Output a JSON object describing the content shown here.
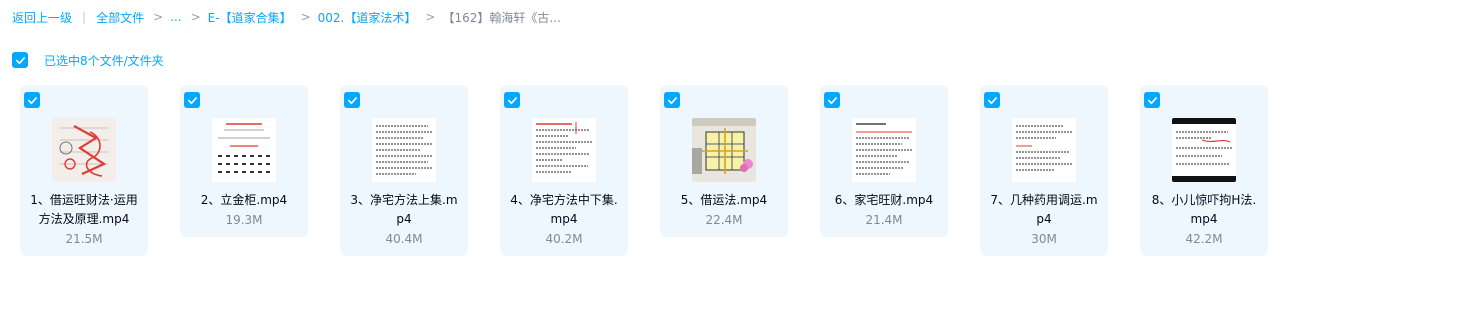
{
  "breadcrumb": {
    "back": "返回上一级",
    "separator": "|",
    "all_files": "全部文件",
    "ellipsis": "...",
    "level1": "E-【道家合集】",
    "level2": "002.【道家法术】",
    "current": "【162】翰海轩《古..."
  },
  "selection": {
    "text": "已选中8个文件/文件夹",
    "checked": true
  },
  "files": [
    {
      "name": "1、借运旺财法·运用方法及原理.mp4",
      "size": "21.5M",
      "thumb_icon": "red-ink-talisman-thumbnail"
    },
    {
      "name": "2、立金柜.mp4",
      "size": "19.3M",
      "thumb_icon": "character-grid-thumbnail"
    },
    {
      "name": "3、净宅方法上集.mp4",
      "size": "40.4M",
      "thumb_icon": "text-document-thumbnail"
    },
    {
      "name": "4、净宅方法中下集.mp4",
      "size": "40.2M",
      "thumb_icon": "text-document-red-thumbnail"
    },
    {
      "name": "5、借运法.mp4",
      "size": "22.4M",
      "thumb_icon": "diagram-photo-thumbnail"
    },
    {
      "name": "6、家宅旺财.mp4",
      "size": "21.4M",
      "thumb_icon": "text-document-thumbnail"
    },
    {
      "name": "7、几种药用调运.mp4",
      "size": "30M",
      "thumb_icon": "text-document-thumbnail"
    },
    {
      "name": "8、小儿惊吓拘H法.mp4",
      "size": "42.2M",
      "thumb_icon": "dark-video-frame-thumbnail"
    }
  ],
  "colors": {
    "accent": "#06a7ff",
    "card_bg": "#eef7fe",
    "muted": "#818999"
  }
}
